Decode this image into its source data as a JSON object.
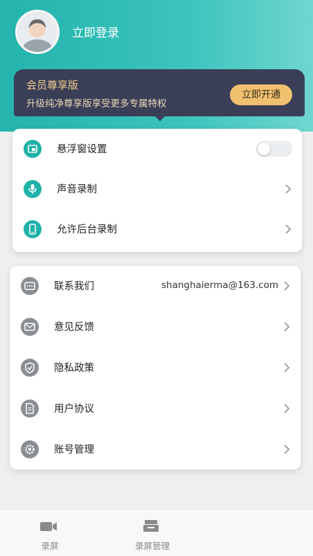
{
  "header": {
    "login_text": "立即登录"
  },
  "vip": {
    "title": "会员尊享版",
    "subtitle": "升级纯净尊享版享受更多专属特权",
    "button": "立即开通"
  },
  "settings_group1": [
    {
      "label": "悬浮窗设置",
      "icon": "floating-window-icon",
      "control": "toggle",
      "toggle_on": false
    },
    {
      "label": "声音录制",
      "icon": "microphone-icon",
      "control": "chevron"
    },
    {
      "label": "允许后台录制",
      "icon": "phone-icon",
      "control": "chevron"
    }
  ],
  "settings_group2": [
    {
      "label": "联系我们",
      "icon": "chat-icon",
      "value": "shanghaierma@163.com",
      "control": "chevron"
    },
    {
      "label": "意见反馈",
      "icon": "mail-icon",
      "control": "chevron"
    },
    {
      "label": "隐私政策",
      "icon": "shield-icon",
      "control": "chevron"
    },
    {
      "label": "用户协议",
      "icon": "document-icon",
      "control": "chevron"
    },
    {
      "label": "账号管理",
      "icon": "gear-icon",
      "control": "chevron"
    }
  ],
  "tabbar": {
    "tab1_label": "录屏",
    "tab2_label": "录屏管理"
  },
  "colors": {
    "accent": "#24b3ad",
    "vip_bg": "#3a3f57",
    "vip_gold": "#f0c06e"
  }
}
